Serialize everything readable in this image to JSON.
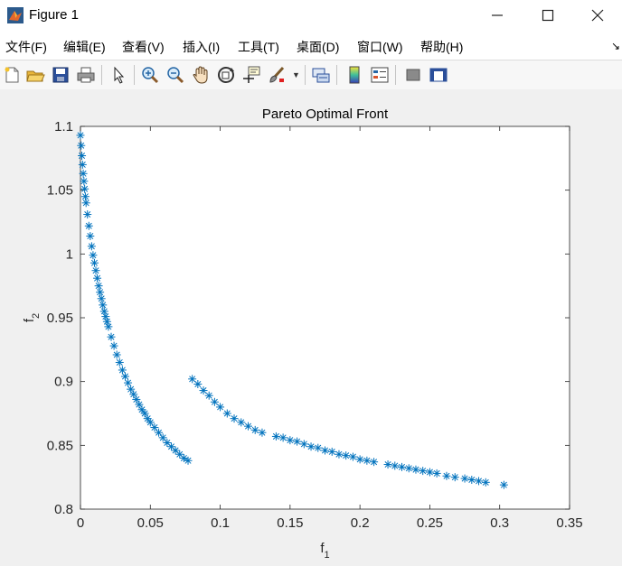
{
  "window": {
    "title": "Figure 1",
    "minimize_icon": "minimize-icon",
    "maximize_icon": "maximize-icon",
    "close_icon": "close-icon"
  },
  "menu": {
    "items": [
      {
        "label": "文件(F)"
      },
      {
        "label": "编辑(E)"
      },
      {
        "label": "查看(V)"
      },
      {
        "label": "插入(I)"
      },
      {
        "label": "工具(T)"
      },
      {
        "label": "桌面(D)"
      },
      {
        "label": "窗口(W)"
      },
      {
        "label": "帮助(H)"
      }
    ],
    "overflow_icon": "chevron-right-icon"
  },
  "toolbar": {
    "icons": [
      "new-figure-icon",
      "open-file-icon",
      "save-icon",
      "print-icon",
      "select-arrow-icon",
      "zoom-in-icon",
      "zoom-out-icon",
      "pan-hand-icon",
      "rotate-3d-icon",
      "data-cursor-icon",
      "brush-icon",
      "link-plot-icon",
      "colorbar-icon",
      "legend-icon",
      "hide-plot-tools-icon",
      "show-plot-tools-icon"
    ],
    "accent": "#0072bd"
  },
  "chart_data": {
    "type": "scatter",
    "title": "Pareto Optimal Front",
    "xlabel": "f",
    "xlabel_sub": "1",
    "ylabel": "f",
    "ylabel_sub": "2",
    "xlim": [
      0,
      0.35
    ],
    "ylim": [
      0.8,
      1.1
    ],
    "xticks": [
      "0",
      "0.05",
      "0.1",
      "0.15",
      "0.2",
      "0.25",
      "0.3",
      "0.35"
    ],
    "yticks": [
      "0.8",
      "0.85",
      "0.9",
      "0.95",
      "1",
      "1.05",
      "1.1"
    ],
    "marker": "*",
    "color": "#0072bd",
    "grid": false,
    "series": [
      {
        "x": [
          0.0,
          0.0005,
          0.001,
          0.0015,
          0.002,
          0.0025,
          0.003,
          0.0035,
          0.004,
          0.005,
          0.006,
          0.007,
          0.008,
          0.009,
          0.01,
          0.011,
          0.012,
          0.013,
          0.014,
          0.015,
          0.016,
          0.017,
          0.018,
          0.019,
          0.02,
          0.022,
          0.024,
          0.026,
          0.028,
          0.03,
          0.032,
          0.034,
          0.036,
          0.038,
          0.04,
          0.042,
          0.044,
          0.046,
          0.048,
          0.05,
          0.053,
          0.056,
          0.059,
          0.062,
          0.065,
          0.068,
          0.071,
          0.074,
          0.077,
          0.08,
          0.084,
          0.088,
          0.092,
          0.096,
          0.1,
          0.105,
          0.11,
          0.115,
          0.12,
          0.125,
          0.13,
          0.14,
          0.145,
          0.15,
          0.155,
          0.16,
          0.165,
          0.17,
          0.175,
          0.18,
          0.185,
          0.19,
          0.195,
          0.2,
          0.205,
          0.21,
          0.22,
          0.225,
          0.23,
          0.235,
          0.24,
          0.245,
          0.25,
          0.255,
          0.262,
          0.268,
          0.275,
          0.28,
          0.285,
          0.29,
          0.303
        ],
        "y": [
          1.093,
          1.085,
          1.077,
          1.07,
          1.063,
          1.057,
          1.051,
          1.045,
          1.04,
          1.031,
          1.022,
          1.014,
          1.006,
          0.999,
          0.993,
          0.987,
          0.981,
          0.975,
          0.97,
          0.965,
          0.96,
          0.955,
          0.951,
          0.947,
          0.943,
          0.935,
          0.928,
          0.921,
          0.915,
          0.909,
          0.904,
          0.899,
          0.894,
          0.89,
          0.886,
          0.882,
          0.878,
          0.875,
          0.871,
          0.868,
          0.864,
          0.86,
          0.856,
          0.852,
          0.849,
          0.846,
          0.843,
          0.84,
          0.838,
          0.902,
          0.898,
          0.893,
          0.889,
          0.884,
          0.88,
          0.875,
          0.871,
          0.868,
          0.865,
          0.862,
          0.86,
          0.857,
          0.856,
          0.854,
          0.853,
          0.851,
          0.849,
          0.848,
          0.846,
          0.845,
          0.843,
          0.842,
          0.841,
          0.839,
          0.838,
          0.837,
          0.835,
          0.834,
          0.833,
          0.832,
          0.831,
          0.83,
          0.829,
          0.828,
          0.826,
          0.825,
          0.824,
          0.823,
          0.822,
          0.821,
          0.819
        ]
      }
    ]
  }
}
